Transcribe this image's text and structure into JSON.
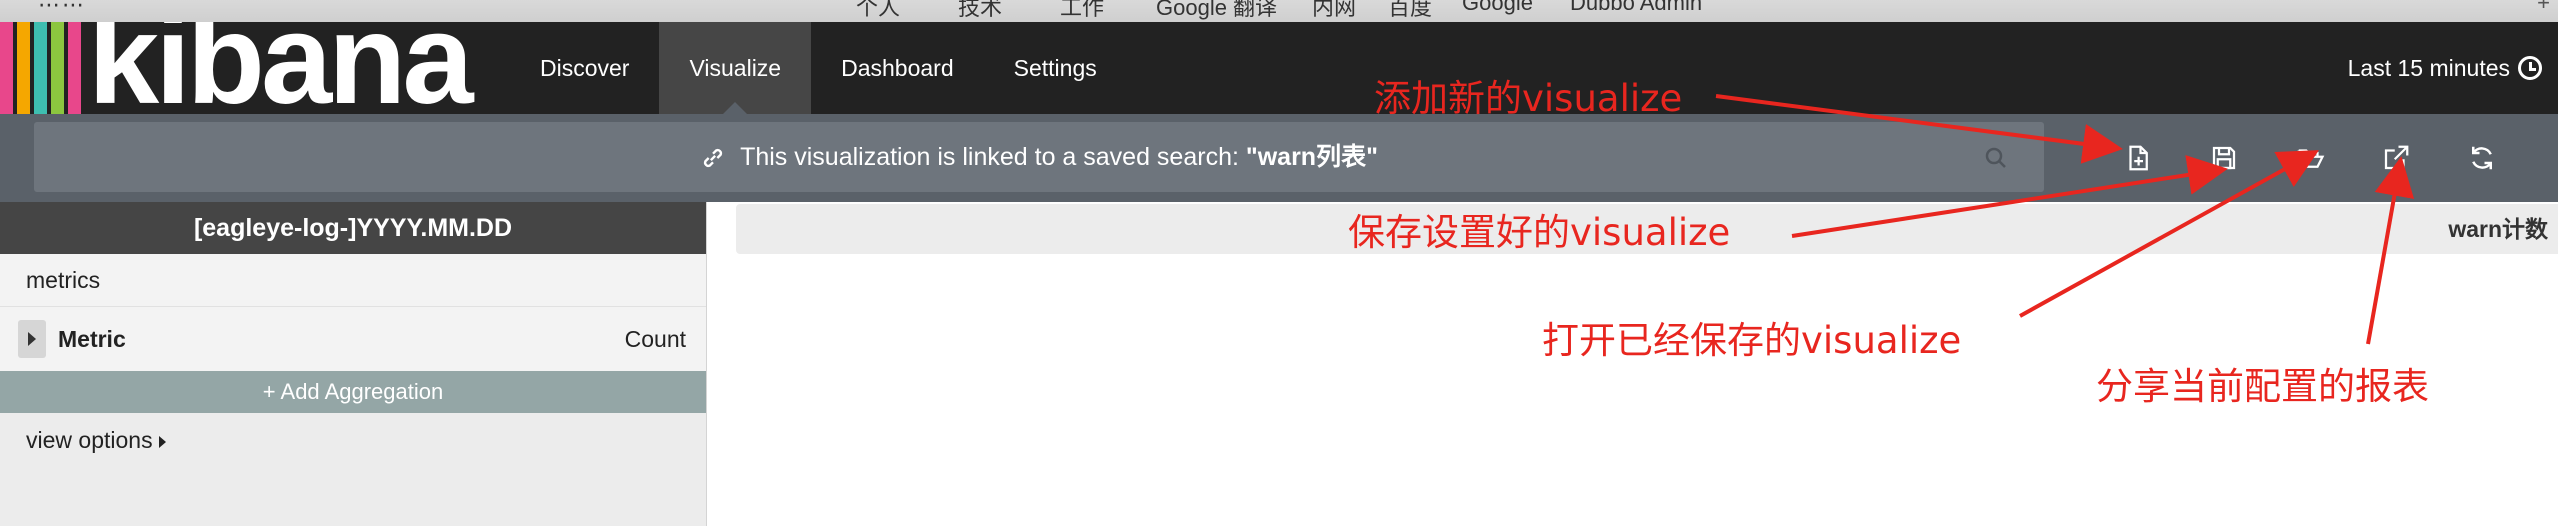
{
  "browser": {
    "bookmarks": [
      "个人",
      "技术",
      "工作",
      "Google 翻译",
      "内网",
      "百度",
      "Google",
      "Dubbo Admin"
    ]
  },
  "app": {
    "logo_text": "kibana",
    "logo_colors": [
      "#e8478b",
      "#f5a700",
      "#3ebeb0",
      "#8cc63f",
      "#e8478b"
    ]
  },
  "nav": {
    "tabs": [
      {
        "label": "Discover",
        "active": false
      },
      {
        "label": "Visualize",
        "active": true
      },
      {
        "label": "Dashboard",
        "active": false
      },
      {
        "label": "Settings",
        "active": false
      }
    ],
    "time_range": "Last 15 minutes"
  },
  "saved_search_bar": {
    "prefix": "This visualization is linked to a saved search: ",
    "saved_search_name": "\"warn列表\""
  },
  "toolbar": {
    "icons": [
      "new-visualization-icon",
      "save-icon",
      "open-folder-icon",
      "share-icon",
      "refresh-icon"
    ]
  },
  "sidebar": {
    "index_pattern": "[eagleye-log-]YYYY.MM.DD",
    "metrics_label": "metrics",
    "metric_name": "Metric",
    "metric_agg": "Count",
    "add_aggregation": "+ Add Aggregation",
    "view_options": "view options"
  },
  "visualization": {
    "title": "warn计数"
  },
  "annotations": {
    "new": "添加新的visualize",
    "save": "保存设置好的visualize",
    "open": "打开已经保存的visualize",
    "share": "分享当前配置的报表",
    "color": "#e8261f"
  }
}
